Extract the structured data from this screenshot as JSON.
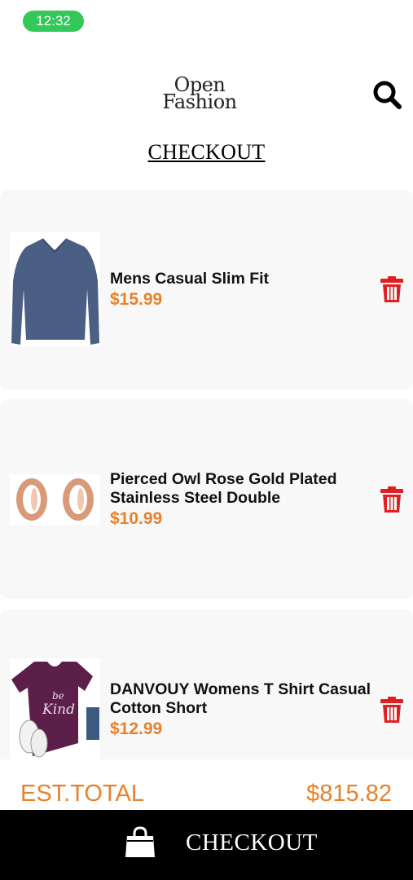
{
  "status_bar": {
    "time": "12:32"
  },
  "header": {
    "logo_line1": "Open",
    "logo_line2": "Fashion",
    "search_icon": "search-icon"
  },
  "page": {
    "title": "CHECKOUT"
  },
  "cart": {
    "items": [
      {
        "name": "Mens Casual Slim Fit",
        "price": "$15.99",
        "image": "navy long-sleeve shirt"
      },
      {
        "name": "Pierced Owl Rose Gold Plated Stainless Steel Double",
        "price": "$10.99",
        "image": "rose gold ear plugs"
      },
      {
        "name": "DANVOUY Womens T Shirt Casual Cotton Short",
        "price": "$12.99",
        "image": "purple be kind t-shirt"
      }
    ]
  },
  "summary": {
    "label": "EST.TOTAL",
    "total": "$815.82"
  },
  "checkout_button": {
    "label": "CHECKOUT",
    "icon": "shopping-bag-icon"
  },
  "colors": {
    "accent": "#e8812b",
    "delete": "#e02020",
    "status": "#34c759",
    "card_bg": "#f8f8f8"
  }
}
